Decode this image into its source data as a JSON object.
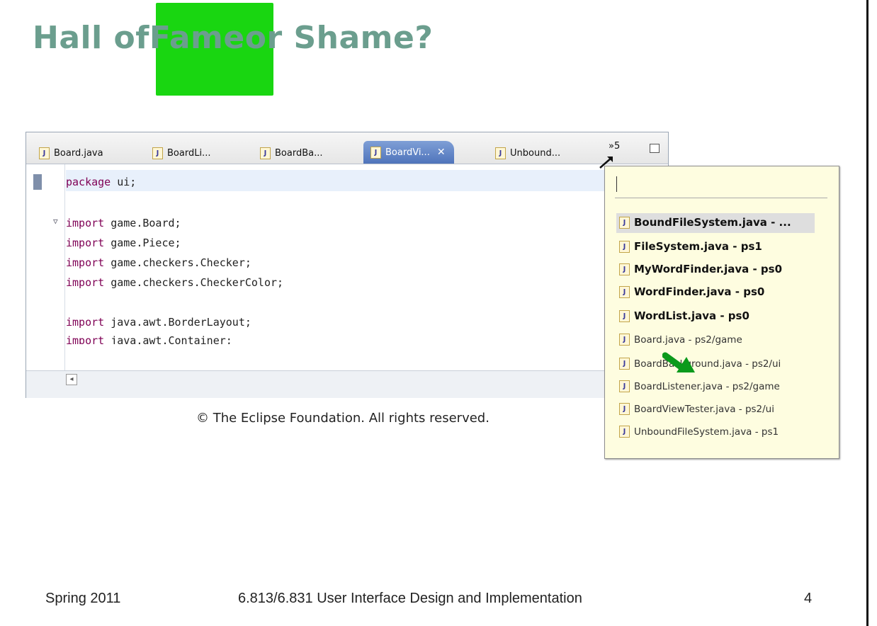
{
  "slide": {
    "title_parts": [
      "Hall of ",
      "Fame",
      " or Shame?"
    ],
    "copyright": "© The Eclipse Foundation. All rights reserved.",
    "footer_left": "Spring 2011",
    "footer_center": "6.813/6.831 User Interface Design and Implementation",
    "page_number": "4",
    "highlight_color": "#19d611",
    "title_color": "#6b9e8e"
  },
  "editor": {
    "tabs": [
      {
        "label": "Board.java",
        "active": false
      },
      {
        "label": "BoardLi...",
        "active": false
      },
      {
        "label": "BoardBa...",
        "active": false
      },
      {
        "label": "BoardVi...",
        "active": true
      },
      {
        "label": "Unbound...",
        "active": false
      }
    ],
    "overflow_label": "»5",
    "code_lines": [
      "package ui;",
      "",
      "import game.Board;",
      "import game.Piece;",
      "import game.checkers.Checker;",
      "import game.checkers.CheckerColor;",
      "",
      "import java.awt.BorderLayout;",
      "import java.awt.Container;"
    ]
  },
  "popup": {
    "filter_value": "",
    "items": [
      {
        "label": "BoundFileSystem.java - ...",
        "bold": true,
        "selected": true
      },
      {
        "label": "FileSystem.java - ps1",
        "bold": true
      },
      {
        "label": "MyWordFinder.java - ps0",
        "bold": true
      },
      {
        "label": "WordFinder.java - ps0",
        "bold": true
      },
      {
        "label": "WordList.java - ps0",
        "bold": true
      },
      {
        "label": "Board.java - ps2/game",
        "bold": false
      },
      {
        "label": "BoardBackground.java - ps2/ui",
        "bold": false
      },
      {
        "label": "BoardListener.java - ps2/game",
        "bold": false
      },
      {
        "label": "BoardViewTester.java - ps2/ui",
        "bold": false
      },
      {
        "label": "UnboundFileSystem.java - ps1",
        "bold": false
      }
    ]
  }
}
